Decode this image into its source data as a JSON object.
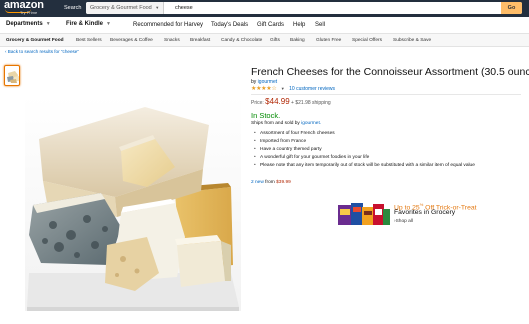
{
  "header": {
    "logo_text": "amazon",
    "logo_sub": "Try Prime",
    "search_label": "Search",
    "search_category": "Grocery & Gourmet Food",
    "search_value": "cheese",
    "go_label": "Go"
  },
  "nav": {
    "departments": "Departments",
    "fire": "Fire & Kindle",
    "recommended": "Recommended for Harvey",
    "deals": "Today's Deals",
    "giftcards": "Gift Cards",
    "help": "Help",
    "sell": "Sell"
  },
  "subnav": {
    "items": [
      "Grocery & Gourmet Food",
      "Best Sellers",
      "Beverages & Coffee",
      "Snacks",
      "Breakfast",
      "Candy & Chocolate",
      "Gifts",
      "Baking",
      "Gluten Free",
      "Special Offers",
      "Subscribe & Save"
    ]
  },
  "back_link": "‹ Back to search results for \"cheese\"",
  "product": {
    "title": "French Cheeses for the Connoisseur Assortment (30.5 ounce)",
    "by_prefix": "by",
    "brand": "igourmet",
    "stars": "★★★★☆",
    "reviews": "10 customer reviews",
    "price_label": "Price:",
    "price": "$44.99",
    "shipping": "+ $21.98 shipping",
    "stock": "In Stock.",
    "ships_prefix": "Ships from and sold by",
    "seller": "igourmet.",
    "bullets": [
      "Assortment of four French cheeses",
      "Imported from France",
      "Have a country themed party",
      "A wonderful gift for your gourmet foodies in your life",
      "Please note that any item temporarily out of stock will be substituted with a similar item of equal value"
    ],
    "new_link": "2 new",
    "new_from": "from",
    "new_price": "$39.99"
  },
  "ad": {
    "headline": "Up to 25",
    "headline_sup": "%",
    "headline_rest": " Off Trick-or-Treat",
    "sub": "Favorites in Grocery",
    "link": "›Shop all"
  },
  "colors": {
    "header_bg": "#232f3e",
    "accent": "#febd69",
    "price": "#b12704",
    "link": "#0066c0",
    "stock": "#008a00"
  }
}
